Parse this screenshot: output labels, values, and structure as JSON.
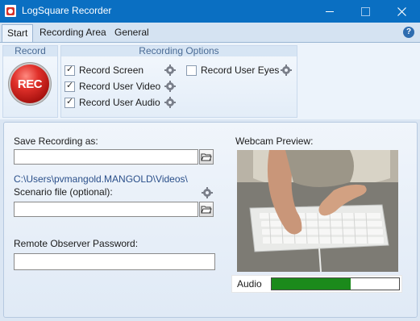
{
  "window": {
    "title": "LogSquare Recorder"
  },
  "tabs": [
    {
      "label": "Start",
      "active": true
    },
    {
      "label": "Recording Area",
      "active": false
    },
    {
      "label": "General",
      "active": false
    }
  ],
  "ribbon": {
    "record_group": {
      "header": "Record",
      "button_label": "REC"
    },
    "options_group": {
      "header": "Recording Options",
      "options": [
        {
          "label": "Record Screen",
          "checked": true
        },
        {
          "label": "Record User Video",
          "checked": true
        },
        {
          "label": "Record User Audio",
          "checked": true
        },
        {
          "label": "Record User Eyes",
          "checked": false
        }
      ]
    }
  },
  "form": {
    "save_label": "Save Recording as:",
    "save_value": "",
    "save_path": "C:\\Users\\pvmangold.MANGOLD\\Videos\\",
    "scenario_label": "Scenario file (optional):",
    "scenario_value": "",
    "password_label": "Remote Observer Password:",
    "password_value": ""
  },
  "preview": {
    "label": "Webcam Preview:",
    "audio_label": "Audio",
    "audio_level": 0.62
  },
  "colors": {
    "titlebar": "#0a6fc2",
    "rec_button": "#d5322b",
    "audio_meter": "#1b8a1b"
  }
}
